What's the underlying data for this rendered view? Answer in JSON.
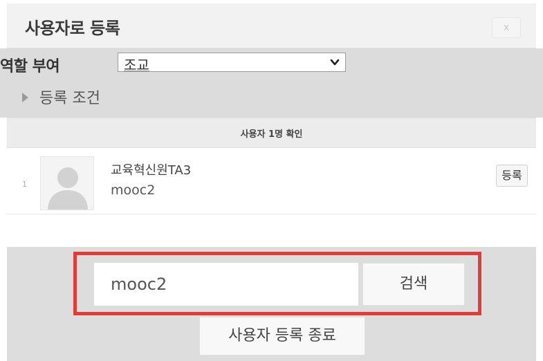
{
  "dialog": {
    "title": "사용자로 등록",
    "close_label": "x"
  },
  "options": {
    "role_label": "역할 부여",
    "role_selected": "조교",
    "conditions_label": "등록 조건"
  },
  "results": {
    "count_text": "사용자 1명 확인",
    "users": [
      {
        "index": "1",
        "name": "교육혁신원TA3",
        "id": "mooc2",
        "action_label": "등록"
      }
    ]
  },
  "footer": {
    "search_value": "mooc2",
    "search_button_label": "검색",
    "finish_button_label": "사용자 등록 종료"
  },
  "colors": {
    "highlight": "#e03c3c",
    "options_bg": "#dcdcdc",
    "footer_bg": "#dddddd"
  }
}
